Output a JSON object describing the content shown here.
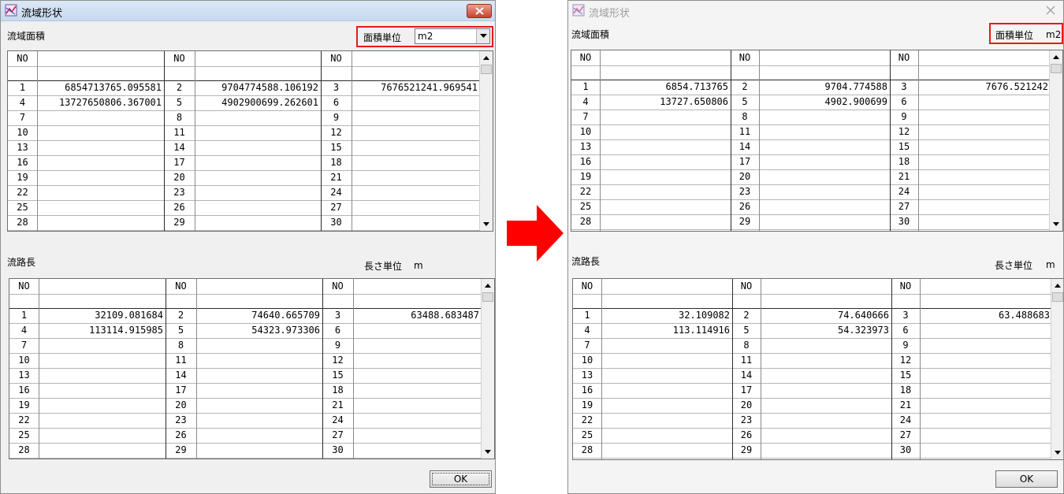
{
  "left_dialog": {
    "title": "流域形状",
    "area_section_label": "流域面積",
    "area_unit_label": "面積単位",
    "area_unit_value": "m2",
    "area_table": {
      "header": "NO",
      "rows": [
        [
          "1",
          "6854713765.095581",
          "2",
          "9704774588.106192",
          "3",
          "7676521241.969541"
        ],
        [
          "4",
          "13727650806.367001",
          "5",
          "4902900699.262601",
          "6",
          ""
        ],
        [
          "7",
          "",
          "8",
          "",
          "9",
          ""
        ],
        [
          "10",
          "",
          "11",
          "",
          "12",
          ""
        ],
        [
          "13",
          "",
          "14",
          "",
          "15",
          ""
        ],
        [
          "16",
          "",
          "17",
          "",
          "18",
          ""
        ],
        [
          "19",
          "",
          "20",
          "",
          "21",
          ""
        ],
        [
          "22",
          "",
          "23",
          "",
          "24",
          ""
        ],
        [
          "25",
          "",
          "26",
          "",
          "27",
          ""
        ],
        [
          "28",
          "",
          "29",
          "",
          "30",
          ""
        ]
      ]
    },
    "length_section_label": "流路長",
    "length_unit_label": "長さ単位",
    "length_unit_value": "m",
    "length_table": {
      "header": "NO",
      "rows": [
        [
          "1",
          "32109.081684",
          "2",
          "74640.665709",
          "3",
          "63488.683487"
        ],
        [
          "4",
          "113114.915985",
          "5",
          "54323.973306",
          "6",
          ""
        ],
        [
          "7",
          "",
          "8",
          "",
          "9",
          ""
        ],
        [
          "10",
          "",
          "11",
          "",
          "12",
          ""
        ],
        [
          "13",
          "",
          "14",
          "",
          "15",
          ""
        ],
        [
          "16",
          "",
          "17",
          "",
          "18",
          ""
        ],
        [
          "19",
          "",
          "20",
          "",
          "21",
          ""
        ],
        [
          "22",
          "",
          "23",
          "",
          "24",
          ""
        ],
        [
          "25",
          "",
          "26",
          "",
          "27",
          ""
        ],
        [
          "28",
          "",
          "29",
          "",
          "30",
          ""
        ]
      ]
    },
    "ok_label": "OK"
  },
  "right_dialog": {
    "title": "流域形状",
    "area_section_label": "流域面積",
    "area_unit_label": "面積単位",
    "area_unit_value": "m2",
    "area_table": {
      "header": "NO",
      "rows": [
        [
          "1",
          "6854.713765",
          "2",
          "9704.774588",
          "3",
          "7676.521242"
        ],
        [
          "4",
          "13727.650806",
          "5",
          "4902.900699",
          "6",
          ""
        ],
        [
          "7",
          "",
          "8",
          "",
          "9",
          ""
        ],
        [
          "10",
          "",
          "11",
          "",
          "12",
          ""
        ],
        [
          "13",
          "",
          "14",
          "",
          "15",
          ""
        ],
        [
          "16",
          "",
          "17",
          "",
          "18",
          ""
        ],
        [
          "19",
          "",
          "20",
          "",
          "21",
          ""
        ],
        [
          "22",
          "",
          "23",
          "",
          "24",
          ""
        ],
        [
          "25",
          "",
          "26",
          "",
          "27",
          ""
        ],
        [
          "28",
          "",
          "29",
          "",
          "30",
          ""
        ]
      ]
    },
    "length_section_label": "流路長",
    "length_unit_label": "長さ単位",
    "length_unit_value": "m",
    "length_table": {
      "header": "NO",
      "rows": [
        [
          "1",
          "32.109082",
          "2",
          "74.640666",
          "3",
          "63.488683"
        ],
        [
          "4",
          "113.114916",
          "5",
          "54.323973",
          "6",
          ""
        ],
        [
          "7",
          "",
          "8",
          "",
          "9",
          ""
        ],
        [
          "10",
          "",
          "11",
          "",
          "12",
          ""
        ],
        [
          "13",
          "",
          "14",
          "",
          "15",
          ""
        ],
        [
          "16",
          "",
          "17",
          "",
          "18",
          ""
        ],
        [
          "19",
          "",
          "20",
          "",
          "21",
          ""
        ],
        [
          "22",
          "",
          "23",
          "",
          "24",
          ""
        ],
        [
          "25",
          "",
          "26",
          "",
          "27",
          ""
        ],
        [
          "28",
          "",
          "29",
          "",
          "30",
          ""
        ]
      ]
    },
    "ok_label": "OK"
  },
  "colors": {
    "highlight_border": "#e8181b",
    "arrow": "#ff0000"
  },
  "icons": [
    "app-icon",
    "close-icon",
    "chevron-down-icon",
    "scroll-up-icon",
    "scroll-down-icon",
    "arrow-right-icon"
  ]
}
